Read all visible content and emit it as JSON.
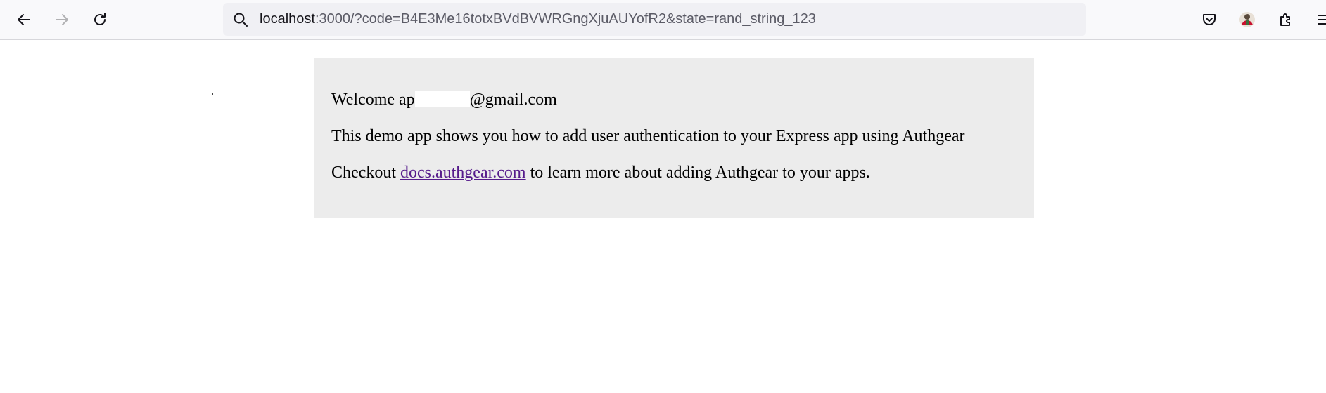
{
  "browser": {
    "url_host": "localhost",
    "url_rest": ":3000/?code=B4E3Me16totxBVdBVWRGngXjuAUYofR2&state=rand_string_123",
    "icons": {
      "back": "arrow-left-icon",
      "forward": "arrow-right-icon",
      "reload": "reload-icon",
      "search": "search-icon",
      "pocket": "pocket-icon",
      "account": "avatar-icon",
      "extensions": "puzzle-icon",
      "menu": "hamburger-menu-icon"
    }
  },
  "page": {
    "welcome_prefix": "Welcome ap",
    "welcome_suffix": "@gmail.com",
    "description": "This demo app shows you how to add user authentication to your Express app using Authgear",
    "checkout_prefix": "Checkout ",
    "docs_link": "docs.authgear.com",
    "checkout_suffix": " to learn more about adding Authgear to your apps."
  },
  "colors": {
    "card_background": "#ececec",
    "link": "#551a8b",
    "toolbar_background": "#f9f9fb",
    "urlbar_background": "#f0f0f4"
  }
}
